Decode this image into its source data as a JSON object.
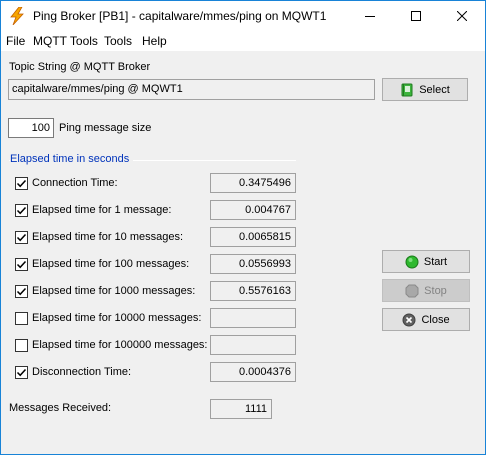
{
  "window": {
    "title": "Ping Broker [PB1] - capitalware/mmes/ping on MQWT1",
    "icon": "lightning-bolt-icon",
    "controls": [
      "minimize-icon",
      "maximize-icon",
      "close-icon"
    ]
  },
  "menu": [
    "File",
    "MQTT Tools",
    "Tools",
    "Help"
  ],
  "topic": {
    "label": "Topic String @ MQTT Broker",
    "value": "capitalware/mmes/ping @ MQWT1",
    "select_label": "Select",
    "select_icon": "book-icon"
  },
  "ping_size": {
    "value": "100",
    "label": "Ping message size"
  },
  "elapsed": {
    "group_title": "Elapsed time in seconds",
    "rows": [
      {
        "label": "Connection Time:",
        "checked": true,
        "value": "0.3475496"
      },
      {
        "label": "Elapsed time for 1 message:",
        "checked": true,
        "value": "0.004767"
      },
      {
        "label": "Elapsed time for 10 messages:",
        "checked": true,
        "value": "0.0065815"
      },
      {
        "label": "Elapsed time for 100 messages:",
        "checked": true,
        "value": "0.0556993"
      },
      {
        "label": "Elapsed time for 1000 messages:",
        "checked": true,
        "value": "0.5576163"
      },
      {
        "label": "Elapsed time for 10000 messages:",
        "checked": false,
        "value": ""
      },
      {
        "label": "Elapsed time for 100000 messages:",
        "checked": false,
        "value": ""
      },
      {
        "label": "Disconnection Time:",
        "checked": true,
        "value": "0.0004376"
      }
    ]
  },
  "messages_received": {
    "label": "Messages Received:",
    "value": "1111"
  },
  "actions": {
    "start_label": "Start",
    "start_icon": "green-circle-icon",
    "stop_label": "Stop",
    "stop_icon": "stop-octagon-icon",
    "close_label": "Close",
    "close_icon": "x-circle-icon"
  },
  "colors": {
    "accent_border": "#1883d7",
    "group_title": "#0033bb",
    "start_green": "#2eb82e"
  }
}
